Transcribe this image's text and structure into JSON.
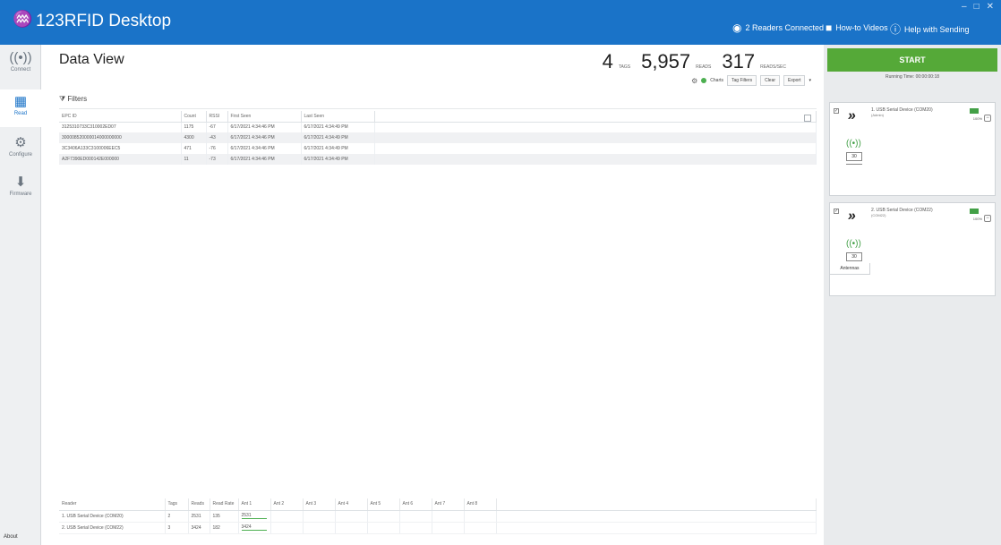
{
  "app": {
    "title": "123RFID Desktop",
    "logo_icon": "zebra-logo-icon",
    "readers_connected": "2 Readers Connected",
    "how_to_videos": "How-to Videos",
    "help": "Help with Sending"
  },
  "nav": {
    "connect": "Connect",
    "read": "Read",
    "configure": "Configure",
    "firmware": "Firmware",
    "about": "About"
  },
  "main": {
    "title": "Data View",
    "stats": {
      "tags_value": "4",
      "tags_unit": "TAGS",
      "reads_value": "5,957",
      "reads_unit": "READS",
      "rate_value": "317",
      "rate_unit": "READS/SEC"
    },
    "toolbar": {
      "charts": "Charts",
      "tag_filters": "Tag Filters",
      "clear": "Clear",
      "export": "Export"
    },
    "filters_label": "Filters",
    "tag_table": {
      "headers": [
        "EPC ID",
        "Count",
        "RSSI",
        "First Seen",
        "Last Seen"
      ],
      "rows": [
        [
          "3125310733C310002ED07",
          "1175",
          "-67",
          "6/17/2021 4:34:46 PM",
          "6/17/2021 4:34:49 PM"
        ],
        [
          "300008520000014000000000",
          "4300",
          "-43",
          "6/17/2021 4:34:46 PM",
          "6/17/2021 4:34:49 PM"
        ],
        [
          "3C3406A133C3100006EEC5",
          "471",
          "-76",
          "6/17/2021 4:34:46 PM",
          "6/17/2021 4:34:49 PM"
        ],
        [
          "A2F7390ED000142E000000",
          "11",
          "-73",
          "6/17/2021 4:34:46 PM",
          "6/17/2021 4:34:49 PM"
        ]
      ]
    },
    "reader_table": {
      "headers": [
        "Reader",
        "Tags",
        "Reads",
        "Read Rate",
        "Ant 1",
        "Ant 2",
        "Ant 3",
        "Ant 4",
        "Ant 5",
        "Ant 6",
        "Ant 7",
        "Ant 8"
      ],
      "rows": [
        [
          "1. USB Serial Device (COM20)",
          "2",
          "2531",
          "135",
          "2531",
          "",
          "",
          "",
          "",
          "",
          "",
          ""
        ],
        [
          "2. USB Serial Device (COM22)",
          "3",
          "3424",
          "182",
          "3424",
          "",
          "",
          "",
          "",
          "",
          "",
          ""
        ]
      ]
    }
  },
  "right": {
    "start_label": "START",
    "running_time": "Running Time: 00:00:00:18",
    "readers": [
      {
        "name": "1. USB Serial Device (COM20)",
        "sub": "(Admin)",
        "battery_pct": "100%",
        "antenna_power": "30"
      },
      {
        "name": "2. USB Serial Device (COM22)",
        "sub": "(COM22)",
        "battery_pct": "100%",
        "antenna_power": "30"
      }
    ],
    "antennas_tab": "Antennas"
  },
  "colors": {
    "titlebar": "#1a73c8",
    "start_green": "#55a938",
    "battery_green": "#43a047"
  }
}
